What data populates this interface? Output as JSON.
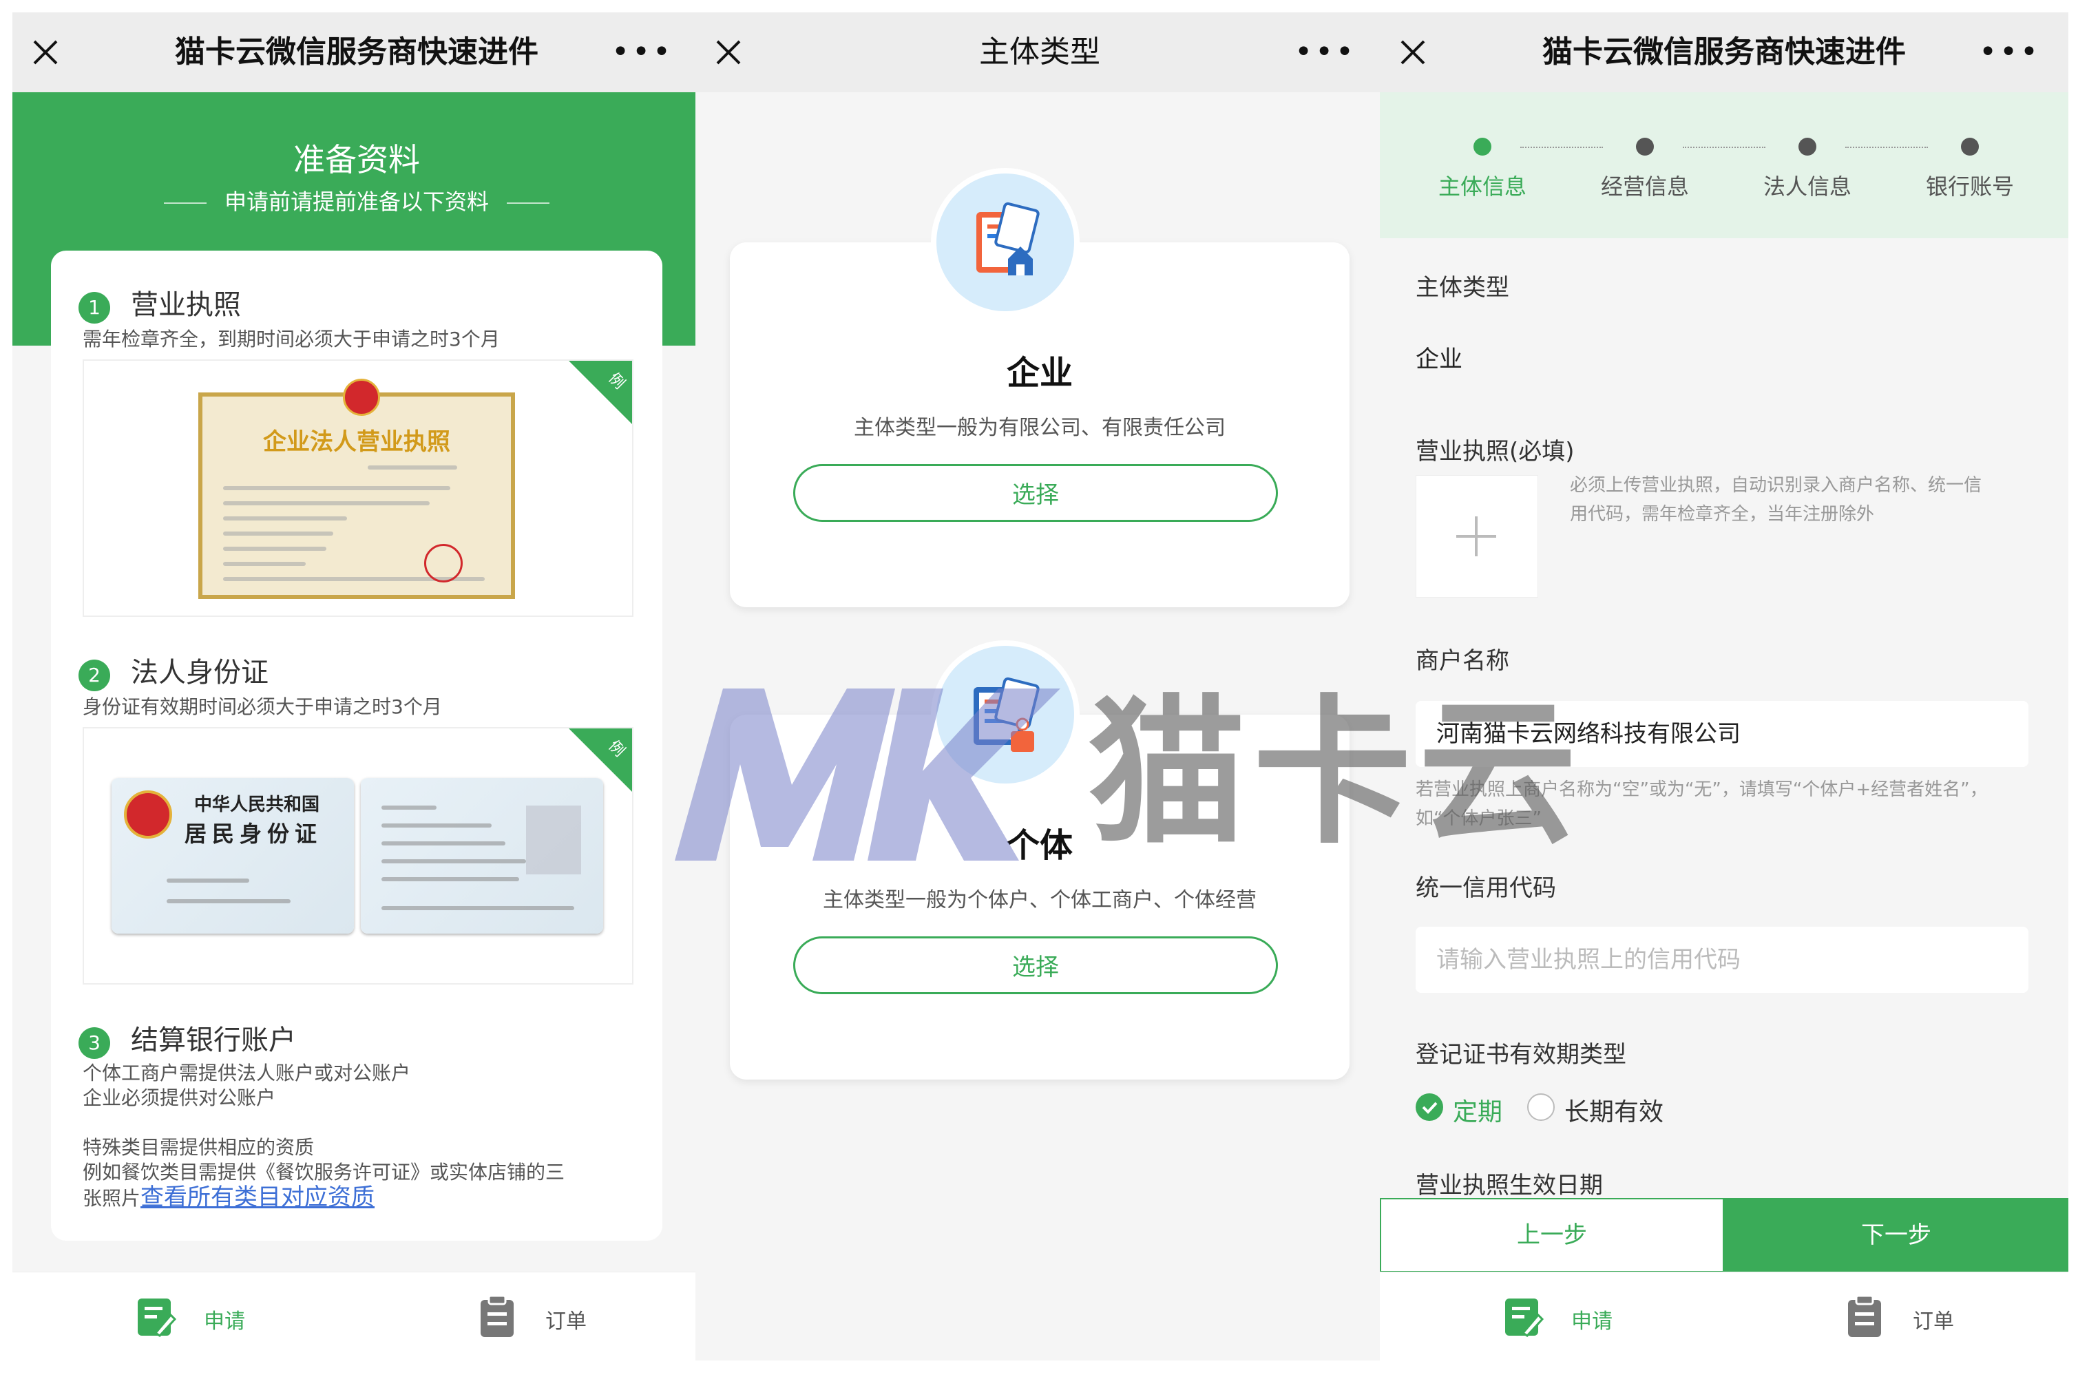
{
  "colors": {
    "accent": "#3aab58",
    "link": "#3d6fd6"
  },
  "screen1": {
    "title": "猫卡云微信服务商快速进件",
    "header_title": "准备资料",
    "header_sub": "申请前请提前准备以下资料",
    "sections": [
      {
        "num": "1",
        "title": "营业执照",
        "desc": "需年检章齐全，到期时间必须大于申请之时3个月",
        "badge": "例"
      },
      {
        "num": "2",
        "title": "法人身份证",
        "desc": "身份证有效期时间必须大于申请之时3个月",
        "badge": "例"
      },
      {
        "num": "3",
        "title": "结算银行账户",
        "desc1": "个体工商户需提供法人账户或对公账户",
        "desc2": "企业必须提供对公账户"
      }
    ],
    "license": {
      "title": "企业法人营业执照"
    },
    "idcard": {
      "line1": "中华人民共和国",
      "line2": "居民身份证"
    },
    "special": {
      "line1": "特殊类目需提供相应的资质",
      "line2": "例如餐饮类目需提供《餐饮服务许可证》或实体店铺的三",
      "line3_prefix": "张照片",
      "link": "查看所有类目对应资质"
    }
  },
  "screen2": {
    "title": "主体类型",
    "cards": [
      {
        "title": "企业",
        "desc": "主体类型一般为有限公司、有限责任公司",
        "button": "选择"
      },
      {
        "title": "个体",
        "desc": "主体类型一般为个体户、个体工商户、个体经营",
        "button": "选择"
      }
    ]
  },
  "watermark": {
    "text": "猫卡云",
    "logo": "MK"
  },
  "screen3": {
    "title": "猫卡云微信服务商快速进件",
    "steps": [
      "主体信息",
      "经营信息",
      "法人信息",
      "银行账号"
    ],
    "active_step": 0,
    "subject_type_label": "主体类型",
    "subject_type_value": "企业",
    "license_label": "营业执照(必填)",
    "license_hint1": "必须上传营业执照，自动识别录入商户名称、统一信",
    "license_hint2": "用代码，需年检章齐全，当年注册除外",
    "merchant_label": "商户名称",
    "merchant_value": "河南猫卡云网络科技有限公司",
    "merchant_hint1": "若营业执照上商户名称为“空”或为“无”，请填写“个体户+经营者姓名”，",
    "merchant_hint2": "如“个体户张三”",
    "credit_label": "统一信用代码",
    "credit_placeholder": "请输入营业执照上的信用代码",
    "validity_label": "登记证书有效期类型",
    "validity_options": [
      "定期",
      "长期有效"
    ],
    "validity_selected": 0,
    "effective_label": "营业执照生效日期",
    "prev_button": "上一步",
    "next_button": "下一步"
  },
  "tabbar": {
    "apply": "申请",
    "orders": "订单"
  },
  "icons": {
    "close": "close-icon",
    "more": "more-icon",
    "apply": "edit-document-icon",
    "orders": "clipboard-icon"
  }
}
